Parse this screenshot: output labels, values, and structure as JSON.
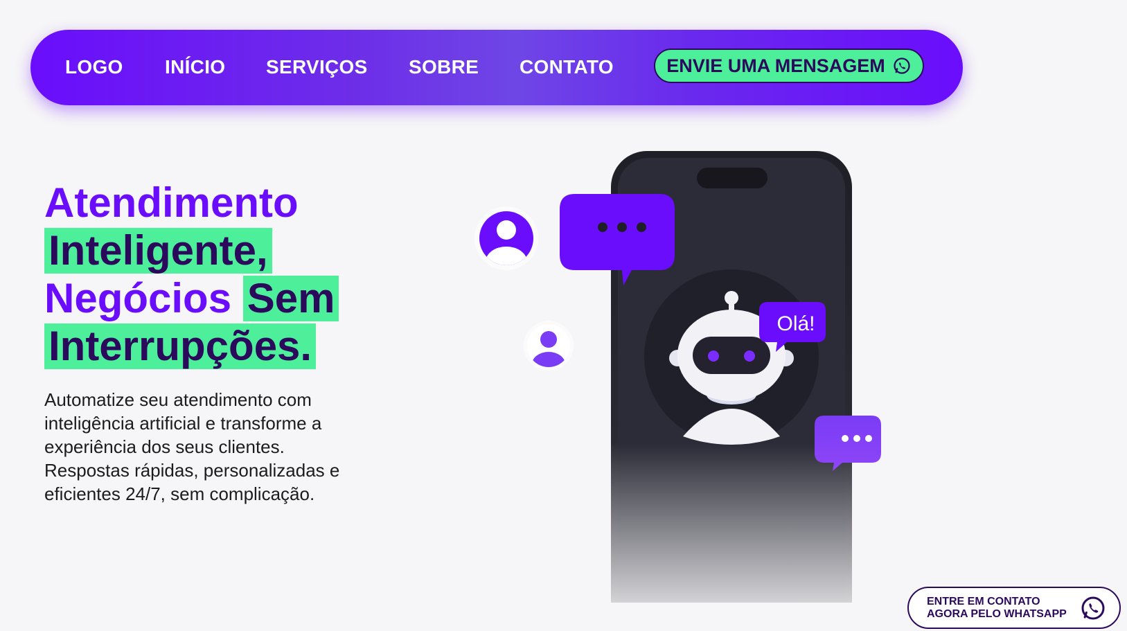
{
  "nav": {
    "logo": "LOGO",
    "links": [
      "INÍCIO",
      "SERVIÇOS",
      "SOBRE",
      "CONTATO"
    ],
    "cta_label": "ENVIE UMA MENSAGEM",
    "cta_icon": "whatsapp-icon"
  },
  "hero": {
    "title_line1": "Atendimento",
    "title_line2": "Inteligente,",
    "title_line3a": "Negócios",
    "title_line3b": "Sem",
    "title_line4": "Interrupções.",
    "description": "Automatize seu atendimento com inteligência artificial e transforme a experiência dos seus clientes. Respostas rápidas, personalizadas e eficientes 24/7, sem complicação."
  },
  "illustration": {
    "robot_greeting": "Olá!",
    "icons": [
      "user-avatar-icon",
      "chat-bubble-icon",
      "robot-icon",
      "phone-icon"
    ]
  },
  "floating_cta": {
    "line1": "ENTRE EM CONTATO",
    "line2": "AGORA PELO WHATSAPP",
    "icon": "whatsapp-icon"
  },
  "colors": {
    "primary": "#6a0dfc",
    "accent": "#4def9b",
    "dark": "#2b0a5c",
    "background": "#f6f5f7"
  }
}
